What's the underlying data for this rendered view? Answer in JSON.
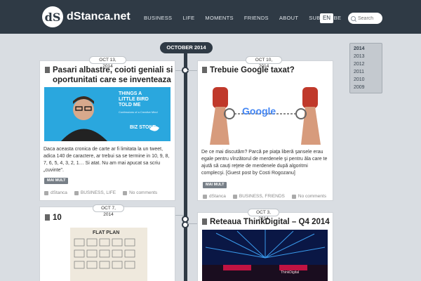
{
  "site": {
    "logo_glyph": "dS",
    "name": "dStanca.net"
  },
  "nav": [
    "BUSINESS",
    "LIFE",
    "MOMENTS",
    "FRIENDS",
    "ABOUT",
    "SUBSCRIBE"
  ],
  "lang": "EN",
  "search": {
    "placeholder": "Search"
  },
  "timeline": {
    "month": "OCTOBER 2014"
  },
  "years": [
    "2014",
    "2013",
    "2012",
    "2011",
    "2010",
    "2009"
  ],
  "posts": [
    {
      "date": "OCT 13, 2014",
      "title": "Pasari albastre, coioti geniali si oportunitati care se inventeaza",
      "image": {
        "label": "THINGS A LITTLE BIRD TOLD ME",
        "sub": "Confessions of a Creative Mind",
        "author": "BIZ STONE"
      },
      "excerpt": "Daca aceasta cronica de carte ar fi limitata la un tweet, adica 140 de caractere, ar trebui sa se termine in 10, 9, 8, 7, 6, 5, 4, 3, 2, 1… Si atat. Nu am mai apucat sa scriu „cuvinte\".",
      "more": "MAI MULT",
      "author": "dStanca",
      "categories": "BUSINESS, LIFE",
      "comments": "No comments"
    },
    {
      "date": "OCT 10, 2014",
      "title": "Trebuie Google taxat?",
      "image": {
        "label": "Google"
      },
      "excerpt": "De ce mai discutăm? Parcă pe piaţa liberă şansele erau egale pentru vînzătorul de merdenele şi pentru ăla care te ajută să cauţi reţete de merdenele după algoritmi complecşi. [Guest post by Costi Rogozanu]",
      "more": "MAI MULT",
      "author": "dStanca",
      "categories": "BUSINESS, FRIENDS",
      "comments": "No comments"
    },
    {
      "date": "OCT 7, 2014",
      "title": "10",
      "image": {
        "label": "FLAT PLAN"
      }
    },
    {
      "date": "OCT 3, 2014",
      "title": "Reteaua ThinkDigital – Q4 2014",
      "image": {
        "label": "ThinkDigital"
      }
    }
  ],
  "colors": {
    "header": "#2f3a45",
    "background": "#d9dde2",
    "accent_blue": "#29a9e0"
  }
}
